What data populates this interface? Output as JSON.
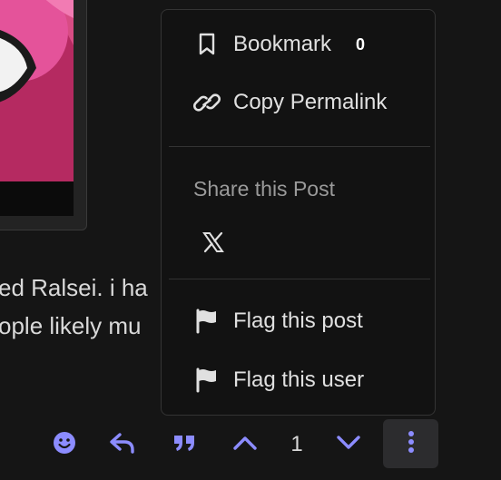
{
  "post": {
    "text_line1": "ed Ralsei. i ha",
    "text_line2": "ople likely mu"
  },
  "menu": {
    "bookmark_label": "Bookmark",
    "bookmark_count": "0",
    "copy_permalink_label": "Copy Permalink",
    "share_heading": "Share this Post",
    "share_targets": [
      "x-logo-icon"
    ],
    "flag_post_label": "Flag this post",
    "flag_user_label": "Flag this user"
  },
  "actions": {
    "vote_count": "1",
    "icons": [
      "emoji-icon",
      "reply-icon",
      "quote-icon",
      "upvote-icon",
      "downvote-icon",
      "more-icon"
    ]
  },
  "colors": {
    "accent": "#8c8cff",
    "background": "#151515",
    "menu_background": "#121212",
    "text": "#e0e0e0",
    "muted_text": "#9a9a9a"
  }
}
